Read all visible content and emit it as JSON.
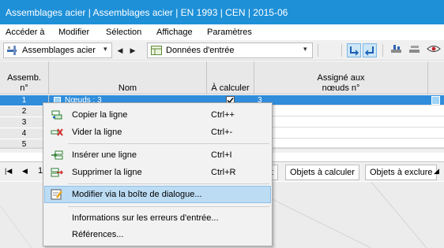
{
  "window": {
    "title": "Assemblages acier | Assemblages acier | EN 1993 | CEN | 2015-06"
  },
  "menu": [
    "Accéder à",
    "Modifier",
    "Sélection",
    "Affichage",
    "Paramètres"
  ],
  "toolbar": {
    "module_combo": "Assemblages acier",
    "table_combo": "Données d'entrée",
    "prev_glyph": "◀",
    "next_glyph": "▶",
    "dropdown_glyph": "▾"
  },
  "table": {
    "headers": {
      "assemb": [
        "Assemb.",
        "n°"
      ],
      "nom": "Nom",
      "a_calculer": "À calculer",
      "assigne": [
        "Assigné aux",
        "nœuds n°"
      ]
    },
    "rows": [
      {
        "num": "1",
        "nom": "Nœuds : 3",
        "a_calculer": true,
        "assigne": "3"
      },
      {
        "num": "2",
        "nom": "",
        "a_calculer": false,
        "assigne": ""
      },
      {
        "num": "3",
        "nom": "",
        "a_calculer": false,
        "assigne": ""
      },
      {
        "num": "4",
        "nom": "",
        "a_calculer": false,
        "assigne": ""
      },
      {
        "num": "5",
        "nom": "",
        "a_calculer": false,
        "assigne": ""
      }
    ]
  },
  "bottom_tabs": {
    "page_number": "1",
    "partial_tab": "t",
    "tabs": [
      "Objets à calculer",
      "Objets à exclure"
    ]
  },
  "context_menu": {
    "items": [
      {
        "label": "Copier la ligne",
        "shortcut": "Ctrl++",
        "icon": "copy-row-icon"
      },
      {
        "label": "Vider la ligne",
        "shortcut": "Ctrl+-",
        "icon": "clear-row-icon"
      },
      {
        "label": "Insérer une ligne",
        "shortcut": "Ctrl+I",
        "icon": "insert-row-icon"
      },
      {
        "label": "Supprimer la ligne",
        "shortcut": "Ctrl+R",
        "icon": "delete-row-icon"
      },
      {
        "label": "Modifier via la boîte de dialogue...",
        "shortcut": "",
        "icon": "edit-dialog-icon"
      },
      {
        "label": "Informations sur les erreurs d'entrée...",
        "shortcut": "",
        "icon": ""
      },
      {
        "label": "Références...",
        "shortcut": "",
        "icon": ""
      }
    ]
  },
  "colors": {
    "titlebar": "#1e90d8",
    "selection": "#2f8ddb",
    "menu_highlight": "#bcdcf4"
  }
}
